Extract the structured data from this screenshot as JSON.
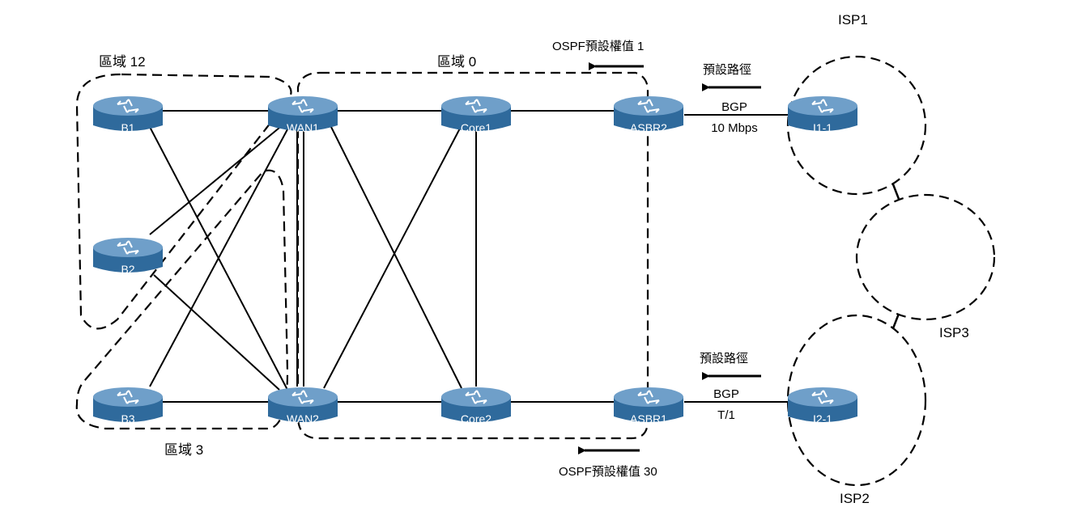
{
  "diagram": {
    "areas": {
      "area12": "區域 12",
      "area0": "區域 0",
      "area3": "區域 3"
    },
    "routers": {
      "B1": "B1",
      "B2": "B2",
      "B3": "B3",
      "WAN1": "WAN1",
      "WAN2": "WAN2",
      "Core1": "Core1",
      "Core2": "Core2",
      "ASBR2": "ASBR2",
      "ASBR1": "ASBR1",
      "I1_1": "I1-1",
      "I2_1": "I2-1"
    },
    "isps": {
      "isp1": "ISP1",
      "isp2": "ISP2",
      "isp3": "ISP3"
    },
    "annotations": {
      "ospf_cost_top": "OSPF預設權值 1",
      "ospf_cost_bottom": "OSPF預設權值 30",
      "default_route_top": "預設路徑",
      "default_route_bottom": "預設路徑",
      "bgp_top": "BGP",
      "bgp_top_speed": "10 Mbps",
      "bgp_bottom": "BGP",
      "bgp_bottom_speed": "T/1"
    },
    "colors": {
      "router_body": "#2f6a9c",
      "router_top": "#6f9fc9",
      "router_text": "#ffffff",
      "line": "#000000"
    }
  }
}
